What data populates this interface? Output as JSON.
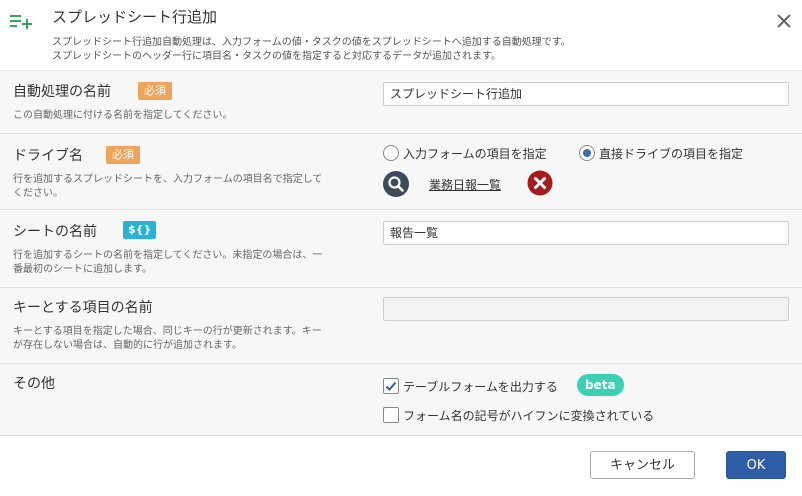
{
  "dialog": {
    "title": "スプレッドシート行追加",
    "desc1": "スプレッドシート行追加自動処理は、入力フォームの値・タスクの値をスプレッドシートへ追加する自動処理です。",
    "desc2": "スプレッドシートのヘッダー行に項目名・タスクの値を指定すると対応するデータが追加されます。"
  },
  "fields": {
    "name": {
      "label": "自動処理の名前",
      "badge": "必須",
      "help": "この自動処理に付ける名前を指定してください。",
      "value": "スプレッドシート行追加"
    },
    "drive": {
      "label": "ドライブ名",
      "badge": "必須",
      "help1": "行を追加するスプレッドシートを、入力フォームの項目名で指定して",
      "help2": "ください。",
      "option1": "入力フォームの項目を指定",
      "option2": "直接ドライブの項目を指定",
      "selected": "option2",
      "link": "業務日報一覧"
    },
    "sheet": {
      "label": "シートの名前",
      "badge": "${}",
      "help1": "行を追加するシートの名前を指定してください。未指定の場合は、一",
      "help2": "番最初のシートに追加します。",
      "value": "報告一覧"
    },
    "key": {
      "label": "キーとする項目の名前",
      "help1": "キーとする項目を指定した場合、同じキーの行が更新されます。キー",
      "help2": "が存在しない場合は、自動的に行が追加されます。",
      "value": ""
    },
    "other": {
      "label": "その他",
      "check1": "テーブルフォームを出力する",
      "check1_checked": true,
      "beta": "beta",
      "check2": "フォーム名の記号がハイフンに変換されている",
      "check2_checked": false
    }
  },
  "buttons": {
    "cancel": "キャンセル",
    "ok": "OK"
  },
  "colors": {
    "accent": "#2f5ea6",
    "required": "#f0a35a",
    "variable": "#2ab1d6",
    "beta": "#3cd1b4",
    "add_icon": "#3aa35a",
    "remove": "#a51d1d"
  }
}
